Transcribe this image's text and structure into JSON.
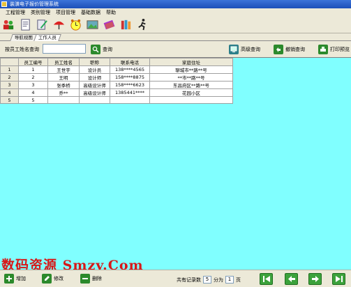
{
  "window": {
    "title": "装潢电子报价管理系统"
  },
  "menubar": {
    "items": [
      "工程管理",
      "类别管理",
      "项目管理",
      "基础数据",
      "帮助"
    ]
  },
  "tabs": [
    {
      "label": "导航视图"
    },
    {
      "label": "工作人员"
    }
  ],
  "search": {
    "label": "按员工姓名查询",
    "value": "",
    "query_button": "查询",
    "advanced_button": "高级查询",
    "cancel_button": "撤销查询",
    "print_button": "打印预览"
  },
  "grid": {
    "columns": [
      "员工编号",
      "员工姓名",
      "职称",
      "联系电话",
      "家庭住址"
    ],
    "row_headers": [
      "1",
      "2",
      "3",
      "4",
      "5"
    ],
    "rows": [
      [
        "1",
        "王世宇",
        "设计员",
        "138****4565",
        "聊城市**路**号"
      ],
      [
        "2",
        "王明",
        "设计师",
        "158****8875",
        "**市**路**号"
      ],
      [
        "3",
        "张季桥",
        "高级设计师",
        "158****6623",
        "东昌府区**路**号"
      ],
      [
        "4",
        "乔**",
        "高级设计师",
        "1385441****",
        "花园小区"
      ],
      [
        "5",
        "",
        "",
        "",
        ""
      ]
    ]
  },
  "footer": {
    "add": "增加",
    "edit": "修改",
    "delete": "删除",
    "total_label": "共有记录数",
    "total_value": "5",
    "pages_label": "分为",
    "pages_value": "1",
    "pages_unit": "页"
  },
  "watermark": "数码资源 Smzy.Com",
  "colors": {
    "grid_bg": "#80ffff",
    "nav_green": "#3ca23c",
    "watermark": "#d71818"
  }
}
